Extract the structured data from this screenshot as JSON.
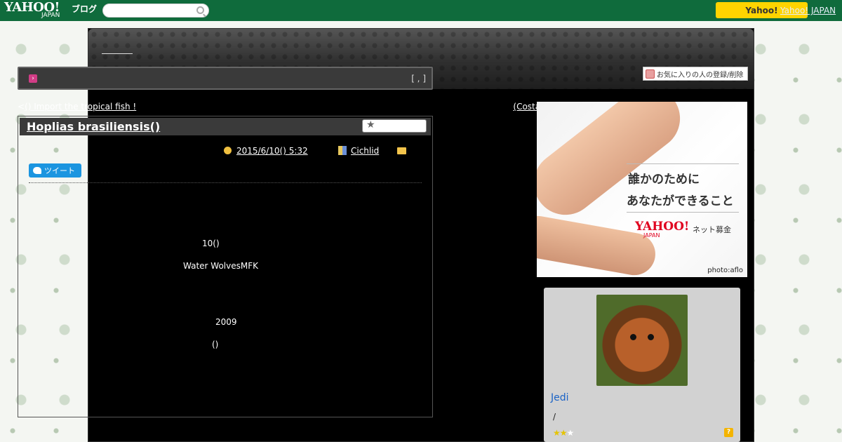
{
  "header": {
    "logo_text": "YAHOO!",
    "logo_sub": "JAPAN",
    "logo_blog": "ブログ",
    "search_placeholder": "",
    "yahoo_button": "Yahoo!",
    "yahoo_japan_link": "Yahoo! JAPAN"
  },
  "blog": {
    "favorite_button": "お気に入りの人の登録/削除"
  },
  "category_bar": {
    "meta": "[ , ]"
  },
  "nav": {
    "prev_arrow": "<",
    "prev_label": "() Import the tropical fish !",
    "next_label": "(Costa Rica Convict)",
    "next_arrow": ">"
  },
  "post": {
    "title": "Hoplias brasiliensis()",
    "date": "2015/6/10()  5:32",
    "category": "Cichlid",
    "tweet_label": "ツイート",
    "body": [
      "10()",
      "Water WolvesMFK",
      "2009",
      "()"
    ]
  },
  "sidebar": {
    "ad": {
      "line1": "誰かのために",
      "line2": "あなたができること",
      "logo": "YAHOO!",
      "logo_sub": "JAPAN",
      "service": "ネット募金",
      "credit": "photo:aflo"
    },
    "profile": {
      "name": "Jedi",
      "separator": "/",
      "rating": 2,
      "rating_max": 3,
      "help": "?"
    }
  }
}
